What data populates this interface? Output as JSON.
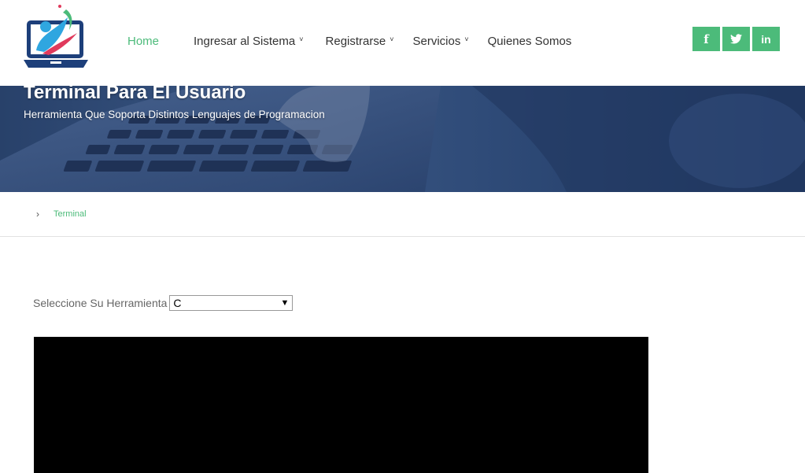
{
  "header": {
    "nav": [
      {
        "label": "Home",
        "active": true,
        "has_dropdown": false
      },
      {
        "label": "Ingresar al Sistema",
        "active": false,
        "has_dropdown": true
      },
      {
        "label": "Registrarse",
        "active": false,
        "has_dropdown": true
      },
      {
        "label": "Servicios",
        "active": false,
        "has_dropdown": true
      },
      {
        "label": "Quienes Somos",
        "active": false,
        "has_dropdown": false
      }
    ],
    "social": [
      {
        "icon": "facebook-icon",
        "glyph": "f"
      },
      {
        "icon": "twitter-icon",
        "glyph": "🐦"
      },
      {
        "icon": "linkedin-icon",
        "glyph": "in"
      }
    ]
  },
  "hero": {
    "title": "Terminal Para El Usuario",
    "subtitle": "Herramienta Que Soporta Distintos Lenguajes de Programacion"
  },
  "breadcrumb": {
    "separator": "›",
    "current": "Terminal"
  },
  "tool_select": {
    "label": "Seleccione Su Herramienta",
    "selected": "C"
  },
  "colors": {
    "accent": "#4cbb7a",
    "terminal_bg": "#000000",
    "hero_bg": "#2f4b78"
  }
}
